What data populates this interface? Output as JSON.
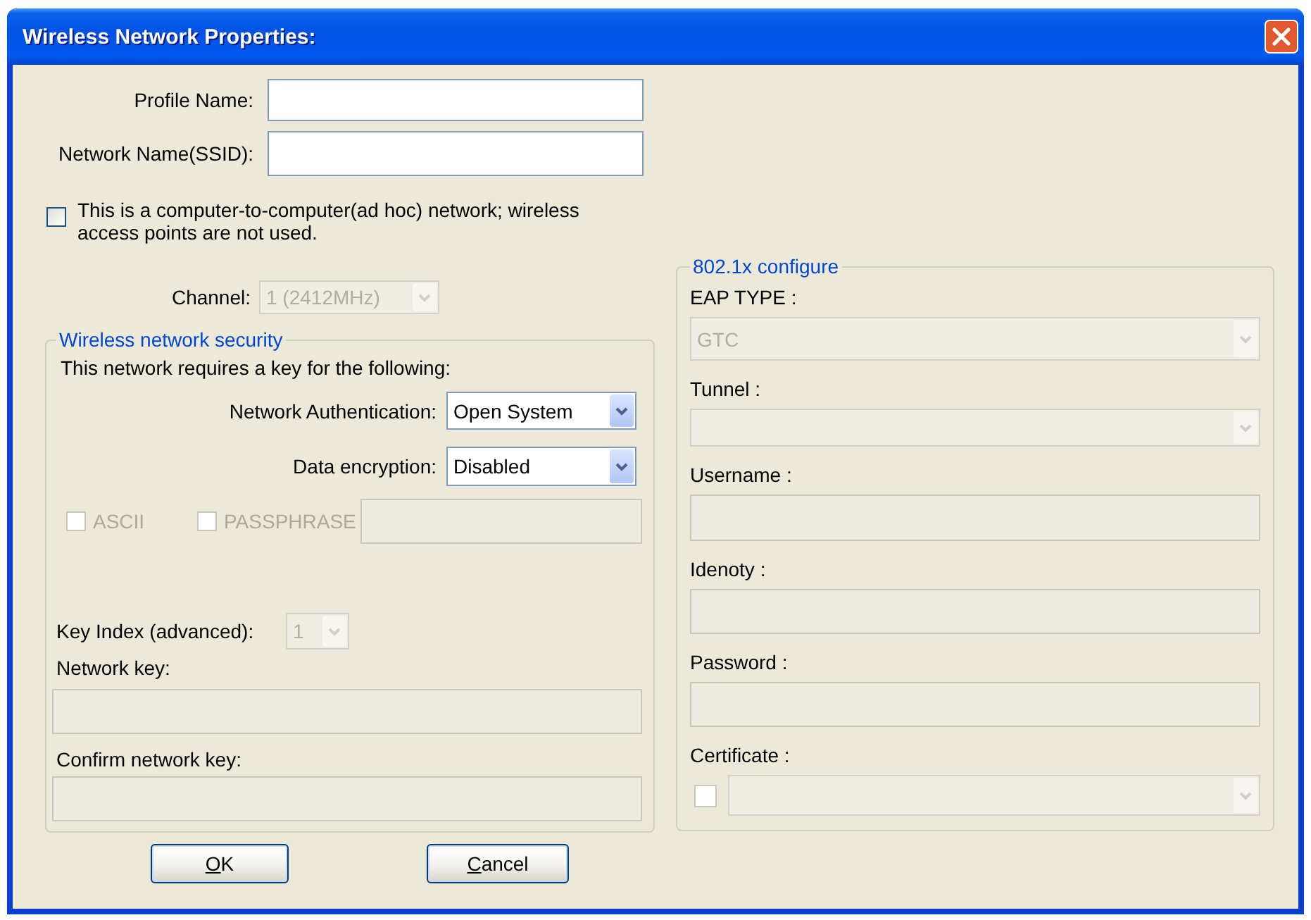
{
  "window": {
    "title": "Wireless Network Properties:"
  },
  "profile_fields": [
    {
      "label": "Profile Name:",
      "disabled": false
    },
    {
      "label": "Network Name(SSID):",
      "disabled": false
    }
  ],
  "ad_hoc": {
    "label": "This is a computer-to-computer(ad hoc) network; wireless access points are not used.",
    "checked": false
  },
  "channel": {
    "label": "Channel:",
    "value": "1 (2412MHz)",
    "disabled": true
  },
  "security": {
    "title": "Wireless network security",
    "intro": "This network requires a key for the following:",
    "dropdowns": [
      {
        "label": "Network Authentication:",
        "value": "Open System",
        "disabled": false
      },
      {
        "label": "Data encryption:",
        "value": "Disabled",
        "disabled": false
      }
    ],
    "options": [
      {
        "label": "ASCII",
        "checked": false,
        "disabled": true
      },
      {
        "label": "PASSPHRASE",
        "checked": false,
        "disabled": true
      }
    ],
    "passphrase_field": {
      "disabled": true
    },
    "key_index": {
      "label": "Key Index (advanced):",
      "value": "1",
      "disabled": true
    },
    "key_fields": [
      {
        "label": "Network key:",
        "disabled": true
      },
      {
        "label": "Confirm network key:",
        "disabled": true
      }
    ]
  },
  "buttons": [
    {
      "label": "OK",
      "mnemonic_first": true
    },
    {
      "label": "Cancel",
      "mnemonic_first": true
    }
  ],
  "eap_config": {
    "title": "802.1x configure",
    "rows": [
      {
        "kind": "dropdown",
        "label": "EAP TYPE :",
        "value": "GTC",
        "disabled": true
      },
      {
        "kind": "dropdown",
        "label": "Tunnel :",
        "disabled": true
      },
      {
        "kind": "text",
        "label": "Username :",
        "disabled": true
      },
      {
        "kind": "text",
        "label": "Idenoty :",
        "disabled": true
      },
      {
        "kind": "text",
        "label": "Password :",
        "disabled": true
      },
      {
        "kind": "check_dropdown",
        "label": "Certificate :",
        "checked": false,
        "disabled": true
      }
    ]
  }
}
